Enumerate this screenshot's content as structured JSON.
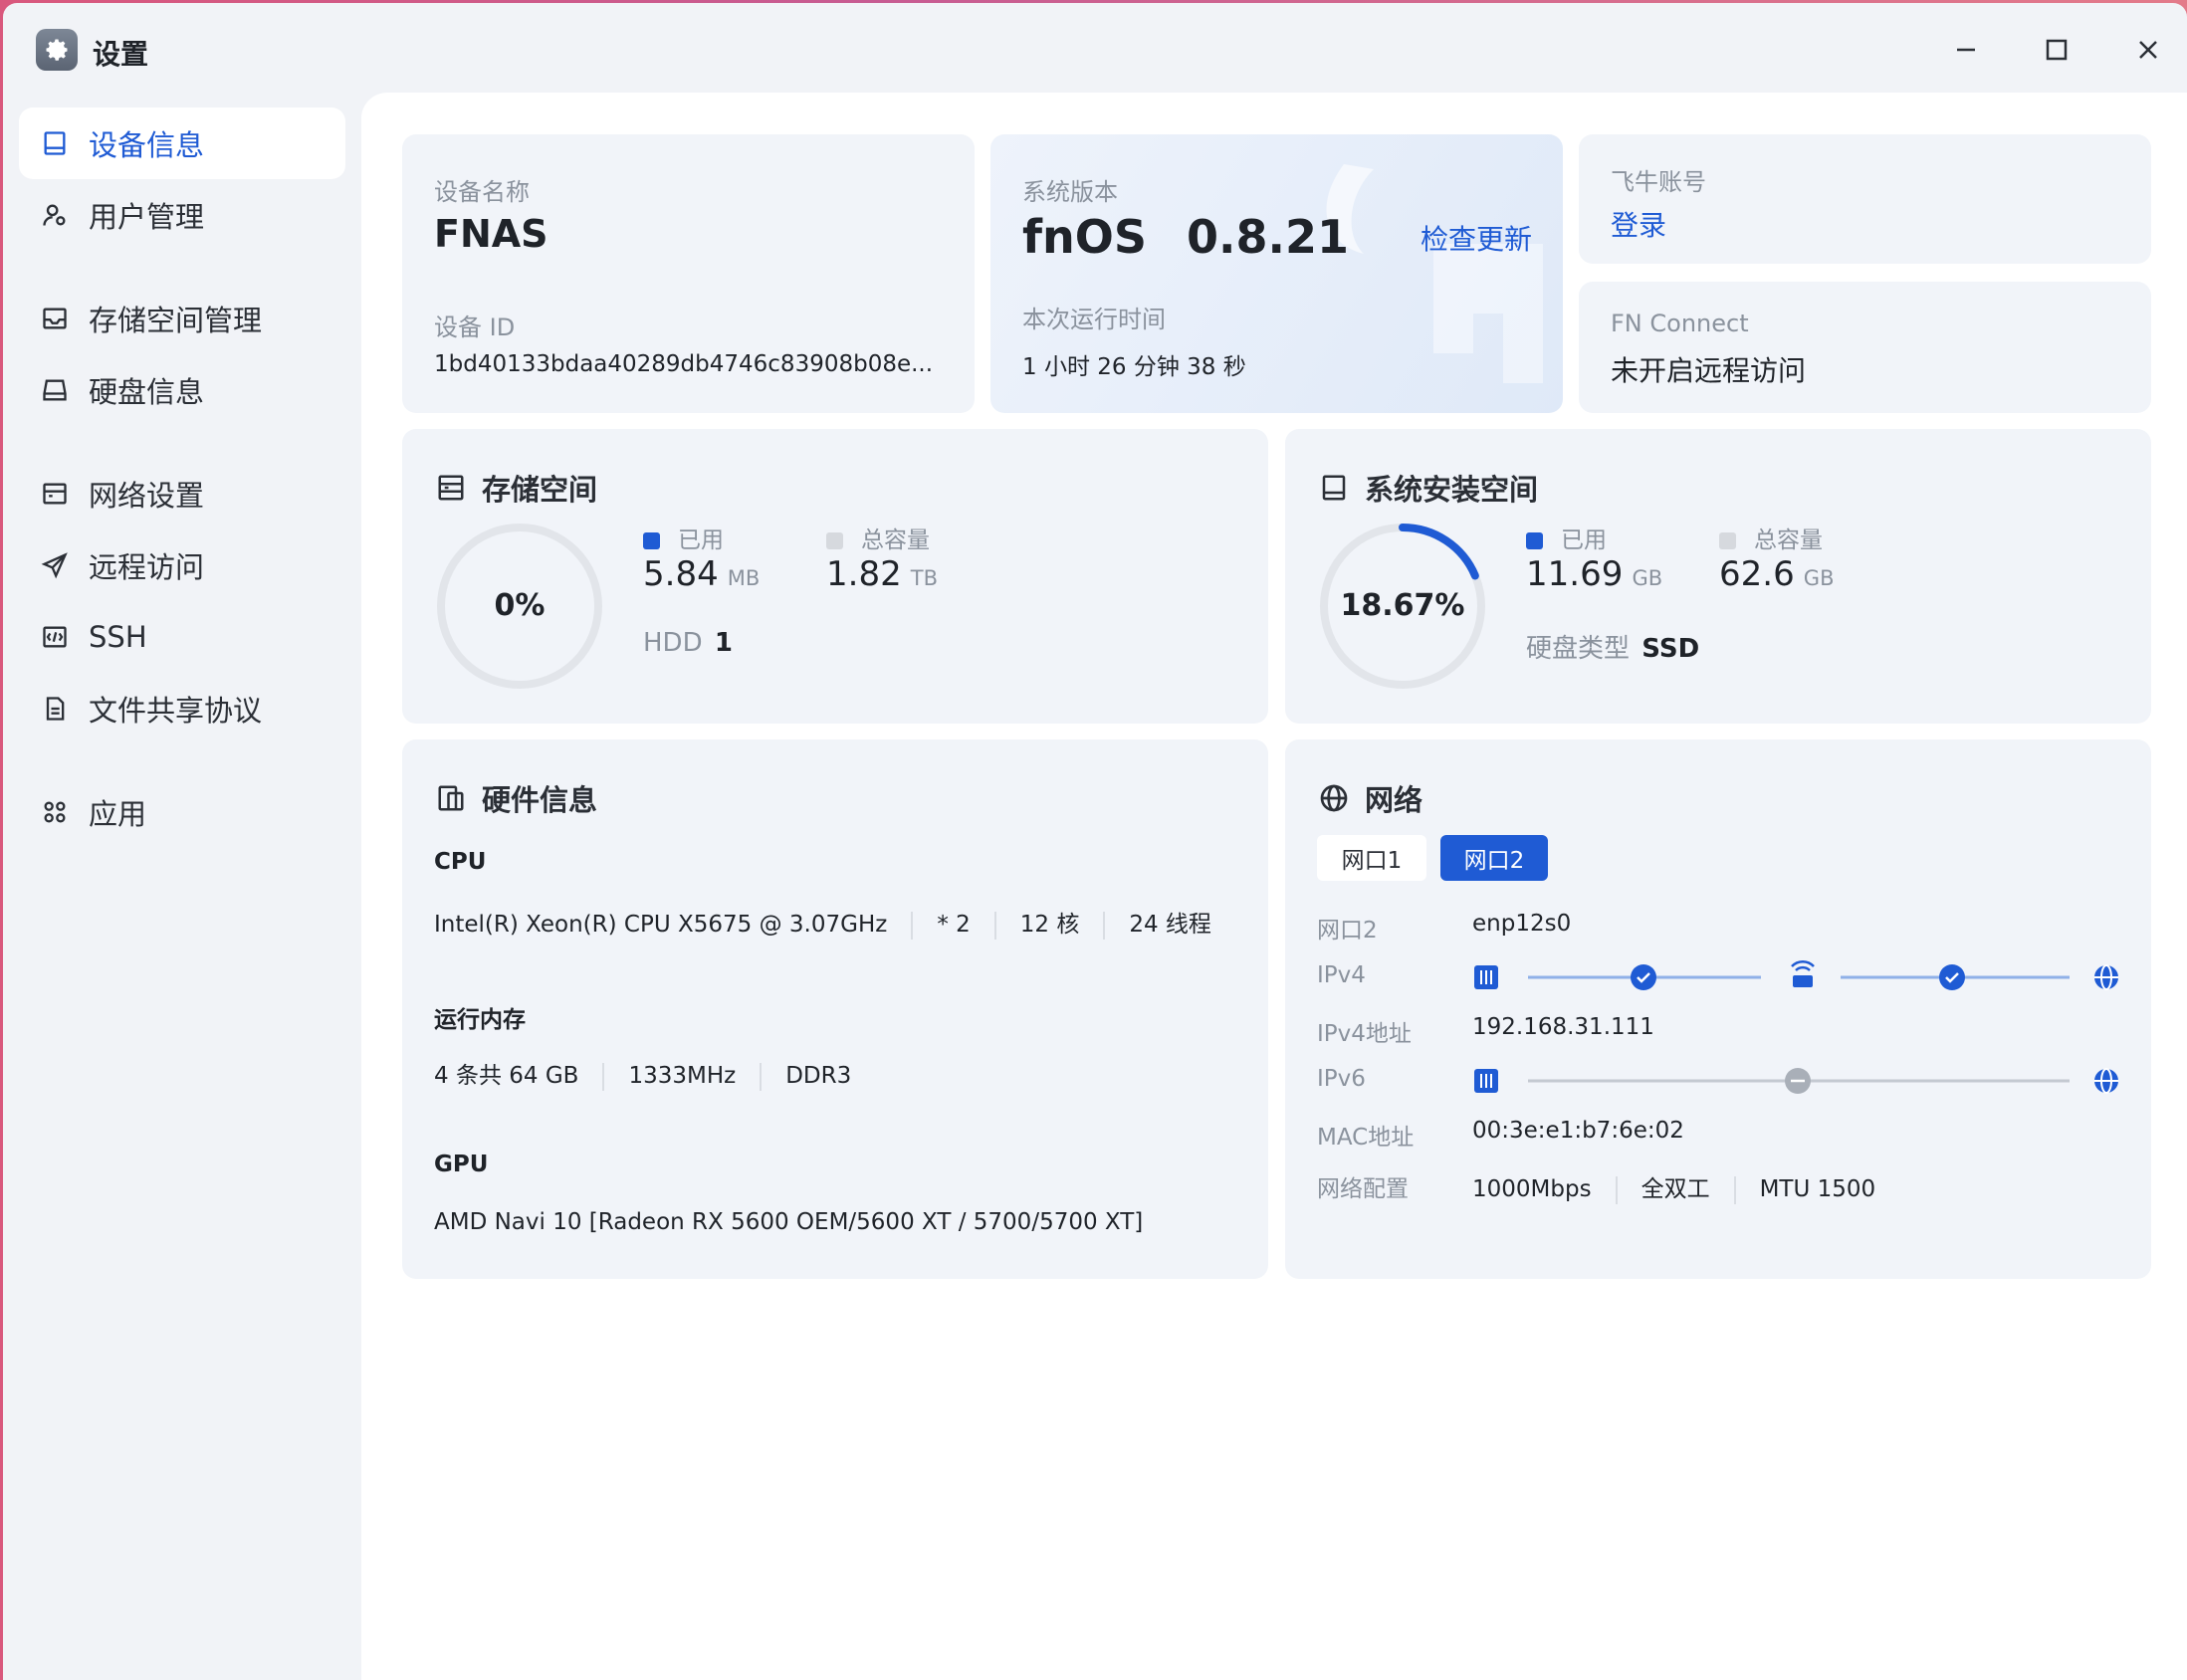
{
  "window": {
    "title": "设置"
  },
  "sidebar": {
    "items": [
      {
        "label": "设备信息",
        "icon": "device-icon",
        "active": true
      },
      {
        "label": "用户管理",
        "icon": "user-icon"
      },
      {
        "label": "存储空间管理",
        "icon": "storage-icon"
      },
      {
        "label": "硬盘信息",
        "icon": "disk-icon"
      },
      {
        "label": "网络设置",
        "icon": "network-icon"
      },
      {
        "label": "远程访问",
        "icon": "send-icon"
      },
      {
        "label": "SSH",
        "icon": "terminal-icon"
      },
      {
        "label": "文件共享协议",
        "icon": "file-icon"
      },
      {
        "label": "应用",
        "icon": "apps-icon"
      }
    ]
  },
  "device": {
    "name_label": "设备名称",
    "name": "FNAS",
    "id_label": "设备 ID",
    "id": "1bd40133bdaa40289db4746c83908b08e..."
  },
  "system": {
    "version_label": "系统版本",
    "os": "fnOS",
    "version": "0.8.21",
    "check_update": "检查更新",
    "uptime_label": "本次运行时间",
    "uptime": "1 小时 26 分钟 38 秒"
  },
  "account": {
    "label": "飞牛账号",
    "login": "登录"
  },
  "fnconnect": {
    "label": "FN Connect",
    "status": "未开启远程访问"
  },
  "storage": {
    "title": "存储空间",
    "percent_text": "0%",
    "used_fraction": 0,
    "used_label": "已用",
    "used_value": "5.84",
    "used_unit": "MB",
    "total_label": "总容量",
    "total_value": "1.82",
    "total_unit": "TB",
    "hdd_label": "HDD",
    "hdd_count": "1"
  },
  "sysdisk": {
    "title": "系统安装空间",
    "percent_text": "18.67%",
    "used_fraction": 0.1867,
    "used_label": "已用",
    "used_value": "11.69",
    "used_unit": "GB",
    "total_label": "总容量",
    "total_value": "62.6",
    "total_unit": "GB",
    "type_label": "硬盘类型",
    "type_value": "SSD"
  },
  "hardware": {
    "title": "硬件信息",
    "cpu_label": "CPU",
    "cpu_model": "Intel(R) Xeon(R) CPU X5675 @ 3.07GHz",
    "cpu_count": "* 2",
    "cpu_cores": "12 核",
    "cpu_threads": "24 线程",
    "mem_label": "运行内存",
    "mem_size": "4 条共 64 GB",
    "mem_speed": "1333MHz",
    "mem_type": "DDR3",
    "gpu_label": "GPU",
    "gpu_model": "AMD Navi 10 [Radeon RX 5600 OEM/5600 XT / 5700/5700 XT]"
  },
  "network": {
    "title": "网络",
    "tabs": [
      "网口1",
      "网口2"
    ],
    "active_tab": 1,
    "rows": {
      "port_key": "网口2",
      "port_val": "enp12s0",
      "ipv4_key": "IPv4",
      "ipv4addr_key": "IPv4地址",
      "ipv4addr_val": "192.168.31.111",
      "ipv6_key": "IPv6",
      "mac_key": "MAC地址",
      "mac_val": "00:3e:e1:b7:6e:02",
      "config_key": "网络配置",
      "speed": "1000Mbps",
      "duplex": "全双工",
      "mtu": "MTU 1500"
    }
  },
  "colors": {
    "accent": "#1f5bd4",
    "card_bg": "#f1f4f9",
    "ring_bg": "#e2e5ea",
    "legend_total": "#d6d9de"
  }
}
